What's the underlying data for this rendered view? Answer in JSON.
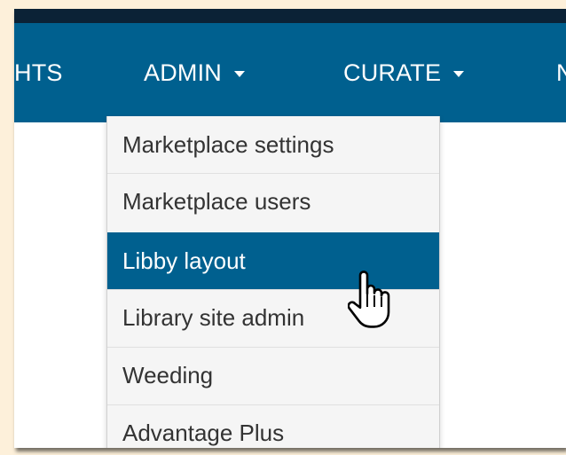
{
  "navbar": {
    "items": [
      {
        "label": "HTS",
        "has_dropdown": false
      },
      {
        "label": "ADMIN",
        "has_dropdown": true
      },
      {
        "label": "CURATE",
        "has_dropdown": true
      },
      {
        "label": "N",
        "has_dropdown": false
      }
    ]
  },
  "admin_menu": {
    "items": [
      {
        "label": "Marketplace settings",
        "active": false
      },
      {
        "label": "Marketplace users",
        "active": false
      },
      {
        "label": "Libby layout",
        "active": true
      },
      {
        "label": "Library site admin",
        "active": false
      },
      {
        "label": "Weeding",
        "active": false
      },
      {
        "label": "Advantage Plus",
        "active": false
      }
    ]
  },
  "colors": {
    "navbar": "#00608f",
    "top_strip": "#0b2236",
    "active_item": "#00608f",
    "page_background": "#fdf0da"
  },
  "icons": {
    "cursor": "hand-pointer-cursor-icon",
    "caret": "caret-down-icon"
  }
}
